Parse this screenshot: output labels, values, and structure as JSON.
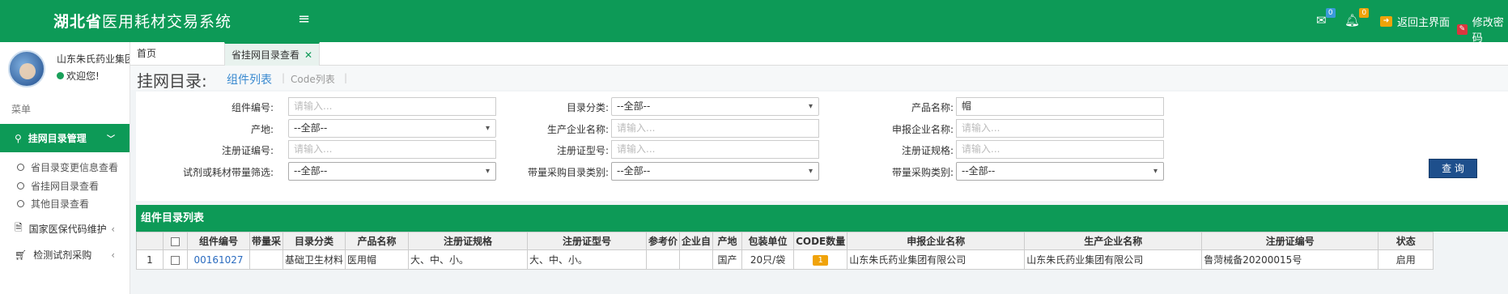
{
  "header": {
    "brand_bold": "湖北省",
    "brand_rest": "医用耗材交易系统",
    "mail_count": "0",
    "bell_count": "0",
    "back_label": "返回主界面",
    "password_label": "修改密码"
  },
  "sidebar": {
    "company": "山东朱氏药业集团",
    "welcome": "欢迎您!",
    "menu_title": "菜单",
    "active_group": "挂网目录管理",
    "sub_items": [
      "省目录变更信息查看",
      "省挂网目录查看",
      "其他目录查看"
    ],
    "items": [
      "国家医保代码维护",
      "检测试剂采购"
    ]
  },
  "tabs": {
    "home": "首页",
    "active": "省挂网目录查看"
  },
  "pagehead": {
    "title": "挂网目录:",
    "link_components": "组件列表",
    "link_code": "Code列表",
    "sep": "|"
  },
  "filters": {
    "component_no": {
      "label": "组件编号:",
      "placeholder": "请输入..."
    },
    "catalog_class": {
      "label": "目录分类:",
      "value": "--全部--"
    },
    "product_name": {
      "label": "产品名称:",
      "value": "帽"
    },
    "origin": {
      "label": "产地:",
      "value": "--全部--"
    },
    "manufacturer": {
      "label": "生产企业名称:",
      "placeholder": "请输入..."
    },
    "applicant": {
      "label": "申报企业名称:",
      "placeholder": "请输入..."
    },
    "reg_no": {
      "label": "注册证编号:",
      "placeholder": "请输入..."
    },
    "reg_model": {
      "label": "注册证型号:",
      "placeholder": "请输入..."
    },
    "reg_spec": {
      "label": "注册证规格:",
      "placeholder": "请输入..."
    },
    "trial_filter": {
      "label": "试剂或耗材带量筛选:",
      "value": "--全部--"
    },
    "volume_catalog": {
      "label": "带量采购目录类别:",
      "value": "--全部--"
    },
    "volume_class": {
      "label": "带量采购类别:",
      "value": "--全部--"
    },
    "query_label": "查 询"
  },
  "list": {
    "title": "组件目录列表",
    "columns": [
      "",
      "",
      "组件编号",
      "带量采",
      "目录分类",
      "产品名称",
      "注册证规格",
      "注册证型号",
      "参考价",
      "企业自",
      "产地",
      "包装单位",
      "CODE数量",
      "申报企业名称",
      "生产企业名称",
      "注册证编号",
      "状态"
    ],
    "rows": [
      {
        "index": "1",
        "component_no": "00161027",
        "volume": "",
        "catalog_class": "基础卫生材料",
        "product_name": "医用帽",
        "spec": "大、中、小。",
        "model": "大、中、小。",
        "ref_price": "",
        "own": "",
        "origin": "国产",
        "pack_unit": "20只/袋",
        "code_count": "1",
        "applicant": "山东朱氏药业集团有限公司",
        "manufacturer": "山东朱氏药业集团有限公司",
        "reg_no": "鲁菏械备20200015号",
        "status": "启用"
      }
    ]
  },
  "colors": {
    "brand_green": "#0d9a57",
    "query_button": "#1e4f8c",
    "badge_orange": "#f0a30a",
    "link_blue": "#2a6bbf"
  }
}
